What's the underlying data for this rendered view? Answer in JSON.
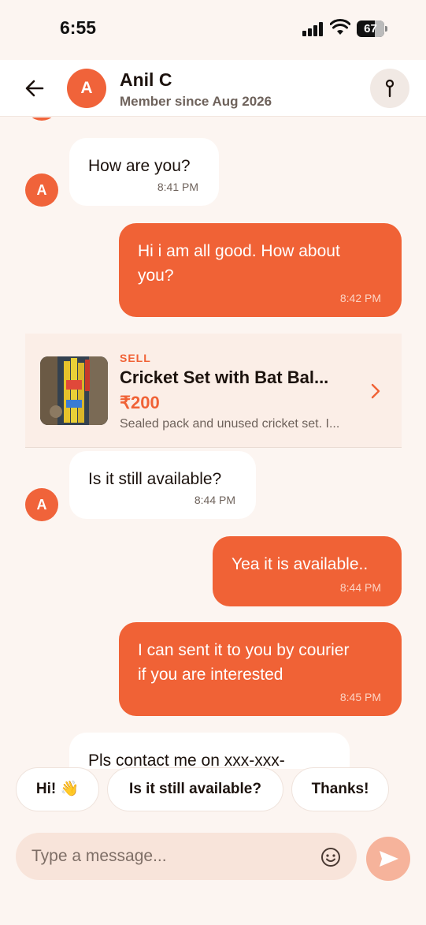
{
  "status_bar": {
    "time": "6:55",
    "battery": "67",
    "battery_fraction": 0.67
  },
  "header": {
    "avatar_initial": "A",
    "name": "Anil C",
    "subtitle": "Member since Aug 2026"
  },
  "messages": [
    {
      "direction": "in",
      "text": "How are you?",
      "time": "8:41 PM",
      "avatar": "A"
    },
    {
      "direction": "out",
      "text_line1": "Hi i am all good. How about",
      "text_line2": "you?",
      "time": "8:42 PM"
    },
    {
      "direction": "in",
      "text": "Is it still available?",
      "time": "8:44 PM",
      "avatar": "A"
    },
    {
      "direction": "out",
      "text": "Yea it is available..",
      "time": "8:44 PM"
    },
    {
      "direction": "out",
      "text_line1": "I can sent it to you by courier",
      "text_line2": "if you are interested",
      "time": "8:45 PM"
    },
    {
      "direction": "in",
      "text": "Pls contact me on xxx-xxx-"
    }
  ],
  "product_card": {
    "tag": "SELL",
    "title": "Cricket Set with Bat Bal...",
    "price": "₹200",
    "description": "Sealed pack and unused cricket set. I..."
  },
  "quick_replies": [
    "Hi! 👋",
    "Is it still available?",
    "Thanks!"
  ],
  "composer": {
    "placeholder": "Type a message..."
  },
  "colors": {
    "accent": "#F06236",
    "incoming_bubble": "#FFFFFF",
    "background": "#FCF5F1"
  },
  "icons": {
    "back": "arrow-left-icon",
    "pin": "pin-icon",
    "chevron": "chevron-right-icon",
    "emoji": "smiley-icon",
    "send": "send-icon"
  }
}
